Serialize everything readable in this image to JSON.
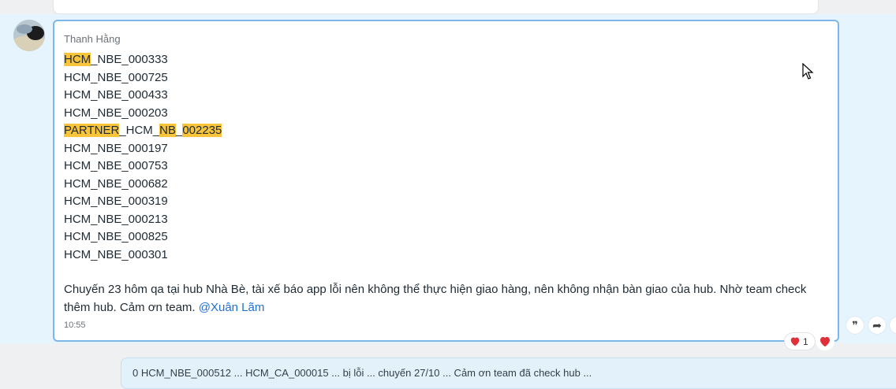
{
  "message": {
    "sender": "Thanh Hằng",
    "lines": [
      {
        "segments": [
          {
            "t": "HCM",
            "hl": true
          },
          {
            "t": "_NBE_000333",
            "hl": false
          }
        ]
      },
      {
        "segments": [
          {
            "t": "HCM_NBE_000725",
            "hl": false
          }
        ]
      },
      {
        "segments": [
          {
            "t": "HCM_NBE_000433",
            "hl": false
          }
        ]
      },
      {
        "segments": [
          {
            "t": "HCM_NBE_000203",
            "hl": false
          }
        ]
      },
      {
        "segments": [
          {
            "t": "PARTNER",
            "hl": true
          },
          {
            "t": "_HCM_",
            "hl": false
          },
          {
            "t": "NB",
            "hl": true
          },
          {
            "t": "_",
            "hl": false
          },
          {
            "t": "002235",
            "hl": true
          }
        ]
      },
      {
        "segments": [
          {
            "t": "HCM_NBE_000197",
            "hl": false
          }
        ]
      },
      {
        "segments": [
          {
            "t": "HCM_NBE_000753",
            "hl": false
          }
        ]
      },
      {
        "segments": [
          {
            "t": "HCM_NBE_000682",
            "hl": false
          }
        ]
      },
      {
        "segments": [
          {
            "t": "HCM_NBE_000319",
            "hl": false
          }
        ]
      },
      {
        "segments": [
          {
            "t": "HCM_NBE_000213",
            "hl": false
          }
        ]
      },
      {
        "segments": [
          {
            "t": "HCM_NBE_000825",
            "hl": false
          }
        ]
      },
      {
        "segments": [
          {
            "t": "HCM_NBE_000301",
            "hl": false
          }
        ]
      }
    ],
    "note_text": "Chuyến 23 hôm qa tại hub Nhà Bè, tài xế báo app lỗi nên không thể thực hiện giao hàng, nên không nhận bàn giao của hub. Nhờ team check thêm hub. Cảm ơn team.",
    "mention": "@Xuân Lãm",
    "time": "10:55",
    "reaction": {
      "icon": "heart-icon",
      "count": "1"
    }
  },
  "actions": [
    {
      "name": "quote-icon",
      "glyph": "❞"
    },
    {
      "name": "share-icon",
      "glyph": "➦"
    }
  ],
  "next_message_preview": "0 HCM_NBE_000512 ... HCM_CA_000015 ... bị lỗi ... chuyến 27/10 ... Cảm ơn team đã check hub ..."
}
